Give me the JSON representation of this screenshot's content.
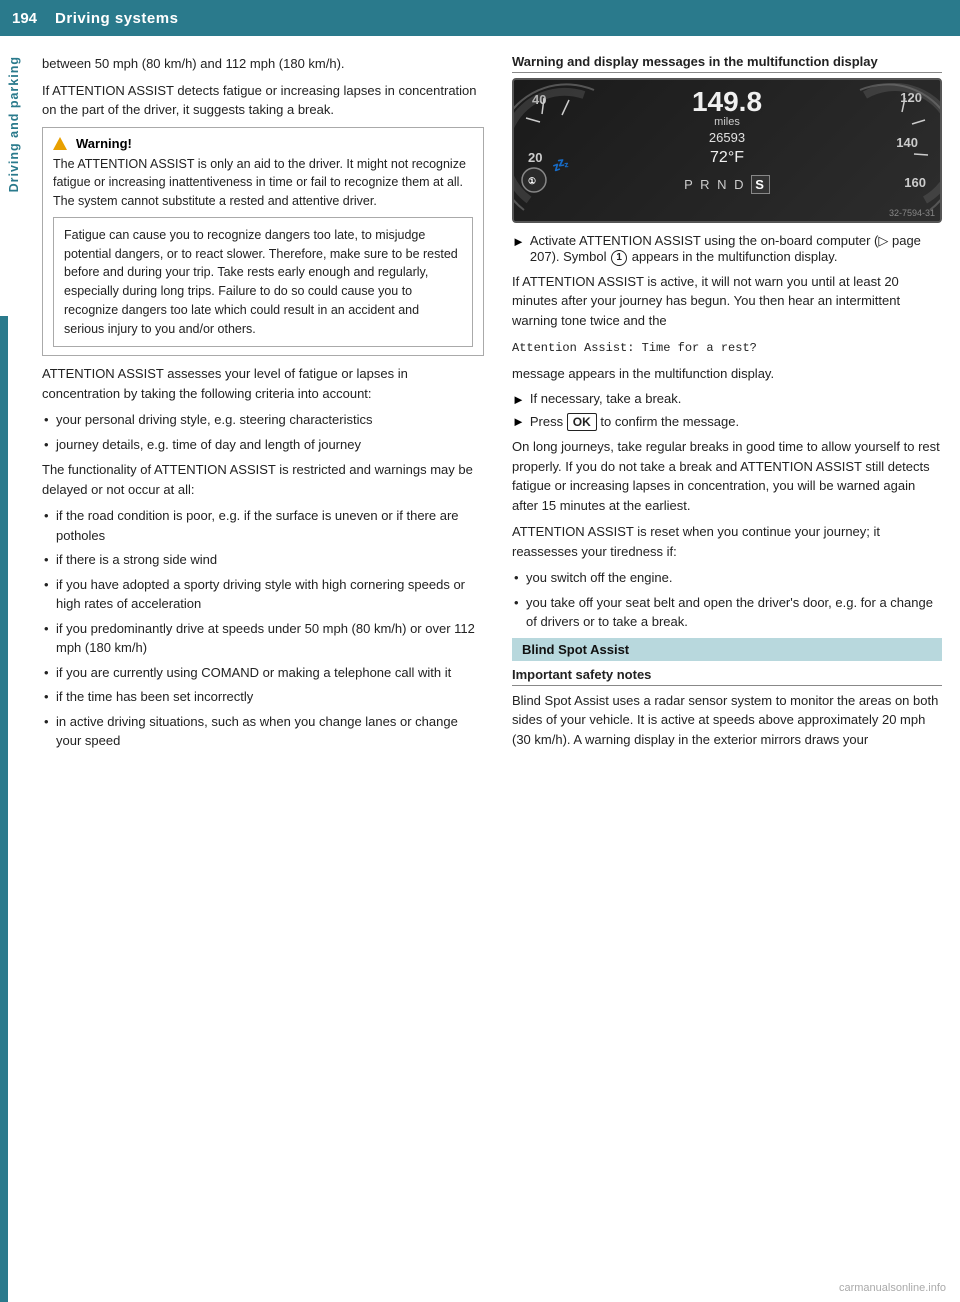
{
  "header": {
    "page_number": "194",
    "title": "Driving systems"
  },
  "sidebar": {
    "label": "Driving and parking"
  },
  "left_col": {
    "intro": {
      "p1": "between 50 mph (80 km/h) and 112 mph (180 km/h).",
      "p2": "If ATTENTION ASSIST detects fatigue or increasing lapses in concentration on the part of the driver, it suggests taking a break."
    },
    "warning": {
      "title": "Warning!",
      "body1": "The ATTENTION ASSIST is only an aid to the driver. It might not recognize fatigue or increasing inattentiveness in time or fail to recognize them at all. The system cannot substitute a rested and attentive driver.",
      "body2": "Fatigue can cause you to recognize dangers too late, to misjudge potential dangers, or to react slower. Therefore, make sure to be rested before and during your trip. Take rests early enough and regularly, especially during long trips. Failure to do so could cause you to recognize dangers too late which could result in an accident and serious injury to you and/or others."
    },
    "assesses_p1": "ATTENTION ASSIST assesses your level of fatigue or lapses in concentration by taking the following criteria into account:",
    "criteria_bullets": [
      "your personal driving style, e.g. steering characteristics",
      "journey details, e.g. time of day and length of journey"
    ],
    "functionality_p": "The functionality of ATTENTION ASSIST is restricted and warnings may be delayed or not occur at all:",
    "conditions_bullets": [
      "if the road condition is poor, e.g. if the surface is uneven or if there are potholes",
      "if there is a strong side wind",
      "if you have adopted a sporty driving style with high cornering speeds or high rates of acceleration",
      "if you predominantly drive at speeds under 50 mph (80 km/h) or over 112 mph (180 km/h)",
      "if you are currently using COMAND or making a telephone call with it",
      "if the time has been set incorrectly",
      "in active driving situations, such as when you change lanes or change your speed"
    ]
  },
  "right_col": {
    "warning_display_header": "Warning and display messages in the multifunction display",
    "dashboard": {
      "left_top": "40",
      "left_bottom": "20",
      "center_speed": "149.8",
      "center_unit": "miles",
      "center_odo": "26593",
      "center_temp": "72°F",
      "gear_row": "P R N D S",
      "right_top": "120",
      "right_mid": "140",
      "right_bottom": "160",
      "credit": "32-7594-31"
    },
    "activate_p": "Activate ATTENTION ASSIST using the on-board computer (▷ page 207). Symbol",
    "activate_circle": "①",
    "activate_p2": "appears in the multifunction display.",
    "active_p": "If ATTENTION ASSIST is active, it will not warn you until at least 20 minutes after your journey has begun. You then hear an intermittent warning tone twice and the",
    "monospace_msg": "Attention Assist: Time for a rest?",
    "active_p2": "message appears in the multifunction display.",
    "break_bullet": "If necessary, take a break.",
    "press_bullet_pre": "Press",
    "ok_btn_label": "OK",
    "press_bullet_post": "to confirm the message.",
    "long_journeys_p": "On long journeys, take regular breaks in good time to allow yourself to rest properly. If you do not take a break and ATTENTION ASSIST still detects fatigue or increasing lapses in concentration, you will be warned again after 15 minutes at the earliest.",
    "reset_p": "ATTENTION ASSIST is reset when you continue your journey; it reassesses your tiredness if:",
    "reset_bullets": [
      "you switch off the engine.",
      "you take off your seat belt and open the driver's door, e.g. for a change of drivers or to take a break."
    ],
    "blind_spot_header": "Blind Spot Assist",
    "safety_notes_header": "Important safety notes",
    "blind_spot_p": "Blind Spot Assist uses a radar sensor system to monitor the areas on both sides of your vehicle. It is active at speeds above approximately 20 mph (30 km/h). A warning display in the exterior mirrors draws your"
  },
  "watermark": "carmanualsonline.info"
}
